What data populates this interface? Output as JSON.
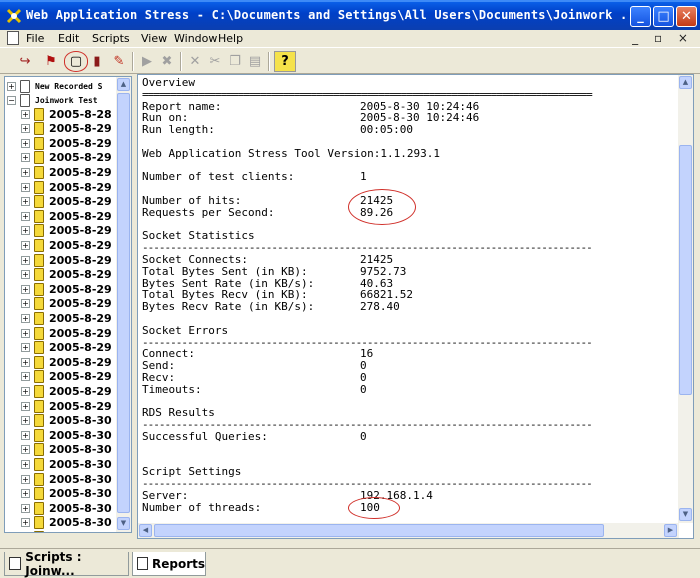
{
  "window": {
    "title": "Web Application Stress - C:\\Documents and Settings\\All Users\\Documents\\Joinwork ..."
  },
  "window_controls": {
    "minimize": "_",
    "maximize": "□",
    "close": "✕"
  },
  "menubar": {
    "items": [
      "File",
      "Edit",
      "Scripts",
      "View",
      "Window",
      "Help"
    ],
    "mdi_controls": "_ ▫ ×"
  },
  "toolbar": {
    "buttons": [
      {
        "name": "open-script",
        "glyph": "↪"
      },
      {
        "name": "run-flag",
        "glyph": "⚑"
      },
      {
        "name": "report-view",
        "glyph": "▢"
      },
      {
        "name": "book",
        "glyph": "▮"
      },
      {
        "name": "tools",
        "glyph": "✎"
      },
      {
        "name": "play",
        "glyph": "▶"
      },
      {
        "name": "stop",
        "glyph": "✖"
      },
      {
        "name": "delete",
        "glyph": "✕"
      },
      {
        "name": "cut",
        "glyph": "✂"
      },
      {
        "name": "copy",
        "glyph": "❐"
      },
      {
        "name": "paste",
        "glyph": "▤"
      },
      {
        "name": "help",
        "glyph": "?"
      }
    ]
  },
  "tree": {
    "roots": [
      "New Recorded S",
      "Joinwork Test"
    ],
    "items": [
      "2005-8-28",
      "2005-8-29",
      "2005-8-29",
      "2005-8-29",
      "2005-8-29",
      "2005-8-29",
      "2005-8-29",
      "2005-8-29",
      "2005-8-29",
      "2005-8-29",
      "2005-8-29",
      "2005-8-29",
      "2005-8-29",
      "2005-8-29",
      "2005-8-29",
      "2005-8-29",
      "2005-8-29",
      "2005-8-29",
      "2005-8-29",
      "2005-8-29",
      "2005-8-29",
      "2005-8-30",
      "2005-8-30",
      "2005-8-30",
      "2005-8-30",
      "2005-8-30",
      "2005-8-30",
      "2005-8-30",
      "2005-8-30",
      "2005-8-30",
      "2005-8-30"
    ]
  },
  "report": {
    "overview_title": "Overview",
    "rule": "================================================================================",
    "dash_rule": "--------------------------------------------------------------------------------",
    "overview": [
      {
        "k": "Report name:",
        "v": "2005-8-30 10:24:46"
      },
      {
        "k": "Run on:",
        "v": "2005-8-30 10:24:46"
      },
      {
        "k": "Run length:",
        "v": "00:05:00"
      }
    ],
    "version": "Web Application Stress Tool Version:1.1.293.1",
    "clients": {
      "k": "Number of test clients:",
      "v": "1"
    },
    "hits": [
      {
        "k": "Number of hits:",
        "v": "21425"
      },
      {
        "k": "Requests per Second:",
        "v": "89.26"
      }
    ],
    "socket_title": "Socket Statistics",
    "socket": [
      {
        "k": "Socket Connects:",
        "v": "21425"
      },
      {
        "k": "Total Bytes Sent (in KB):",
        "v": "9752.73"
      },
      {
        "k": "Bytes Sent Rate (in KB/s):",
        "v": "40.63"
      },
      {
        "k": "Total Bytes Recv (in KB):",
        "v": "66821.52"
      },
      {
        "k": "Bytes Recv Rate (in KB/s):",
        "v": "278.40"
      }
    ],
    "errors_title": "Socket Errors",
    "errors": [
      {
        "k": "Connect:",
        "v": "16"
      },
      {
        "k": "Send:",
        "v": "0"
      },
      {
        "k": "Recv:",
        "v": "0"
      },
      {
        "k": "Timeouts:",
        "v": "0"
      }
    ],
    "rds_title": "RDS Results",
    "rds": [
      {
        "k": "Successful Queries:",
        "v": "0"
      }
    ],
    "script_title": "Script Settings",
    "script": [
      {
        "k": "Server:",
        "v": "192.168.1.4"
      },
      {
        "k": "Number of threads:",
        "v": "100"
      }
    ]
  },
  "tabs": [
    {
      "label": "Scripts : Joinw..."
    },
    {
      "label": "Reports",
      "active": true
    }
  ],
  "colors": {
    "annotation_circle": "#d0302a",
    "title_bar": "#0040c8"
  }
}
